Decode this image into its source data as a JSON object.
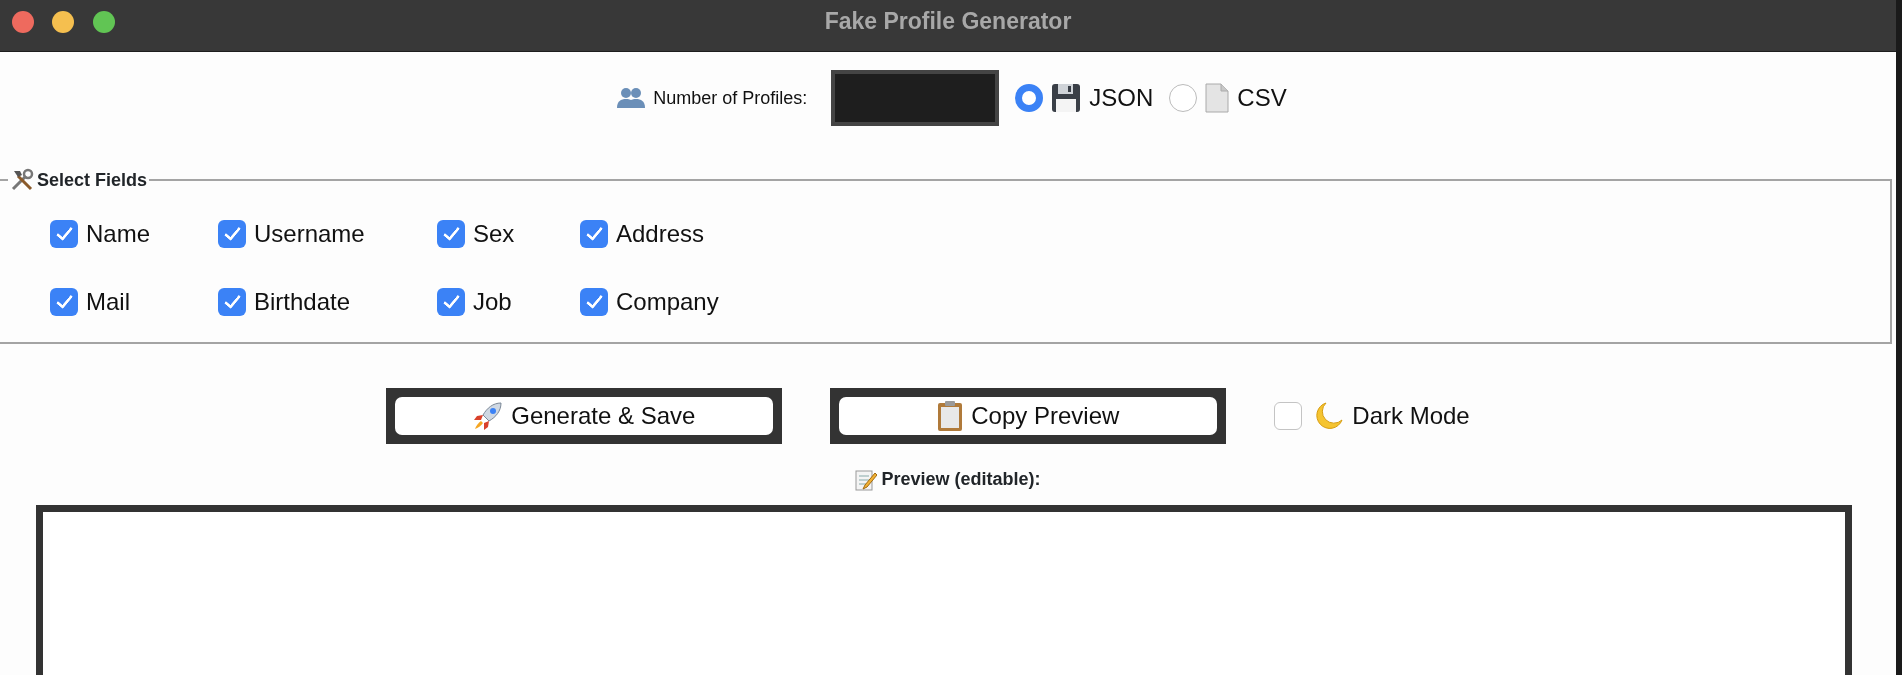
{
  "window": {
    "title": "Fake Profile Generator"
  },
  "count": {
    "label": "Number of Profiles:"
  },
  "formats": [
    {
      "label": "JSON",
      "kind": "floppy",
      "selected": true
    },
    {
      "label": "CSV",
      "kind": "document",
      "selected": false
    }
  ],
  "fields_group": {
    "title": "Select Fields",
    "fields": [
      {
        "label": "Name",
        "checked": true
      },
      {
        "label": "Username",
        "checked": true
      },
      {
        "label": "Sex",
        "checked": true
      },
      {
        "label": "Address",
        "checked": true
      },
      {
        "label": "Mail",
        "checked": true
      },
      {
        "label": "Birthdate",
        "checked": true
      },
      {
        "label": "Job",
        "checked": true
      },
      {
        "label": "Company",
        "checked": true
      }
    ]
  },
  "buttons": [
    {
      "label": "Generate & Save",
      "kind": "rocket"
    },
    {
      "label": "Copy Preview",
      "kind": "clipboard"
    }
  ],
  "dark_mode": {
    "label": "Dark Mode",
    "checked": false
  },
  "preview": {
    "label": "Preview (editable):"
  }
}
